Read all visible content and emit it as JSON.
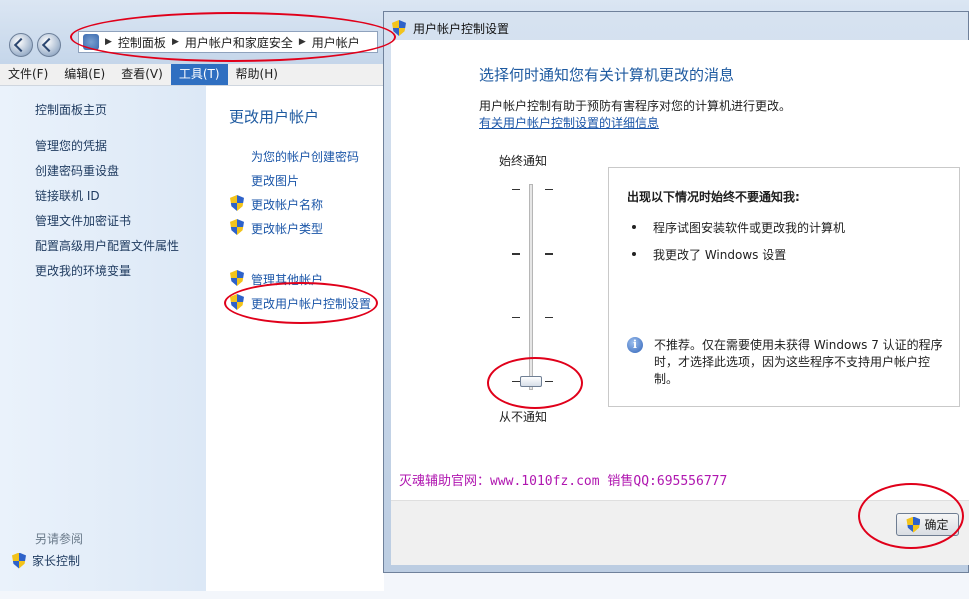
{
  "breadcrumb": [
    "控制面板",
    "用户帐户和家庭安全",
    "用户帐户"
  ],
  "menu": [
    "文件(F)",
    "编辑(E)",
    "查看(V)",
    "工具(T)",
    "帮助(H)"
  ],
  "menu_active_index": 3,
  "left_links": {
    "home": "控制面板主页",
    "items": [
      "管理您的凭据",
      "创建密码重设盘",
      "链接联机 ID",
      "管理文件加密证书",
      "配置高级用户配置文件属性",
      "更改我的环境变量"
    ]
  },
  "see_also": {
    "label": "另请参阅",
    "parental": "家长控制"
  },
  "main": {
    "title": "更改用户帐户",
    "tasks": [
      "为您的帐户创建密码",
      "更改图片",
      "更改帐户名称",
      "更改帐户类型"
    ],
    "tasks2": [
      "管理其他帐户",
      "更改用户帐户控制设置"
    ]
  },
  "dialog": {
    "title": "用户帐户控制设置",
    "heading": "选择何时通知您有关计算机更改的消息",
    "desc": "用户帐户控制有助于预防有害程序对您的计算机进行更改。",
    "more_link": "有关用户帐户控制设置的详细信息",
    "slider_top": "始终通知",
    "slider_bottom": "从不通知",
    "slider_level": 0,
    "info_title": "出现以下情况时始终不要通知我:",
    "bullets": [
      "程序试图安装软件或更改我的计算机",
      "我更改了 Windows 设置"
    ],
    "note": "不推荐。仅在需要使用未获得 Windows 7 认证的程序时，才选择此选项，因为这些程序不支持用户帐户控制。",
    "ok": "确定"
  },
  "promo": "灭魂辅助官网：www.1010fz.com  销售QQ:695556777",
  "colors": {
    "link": "#1b56a8",
    "heading": "#1e5aa0",
    "annotation": "#e0001a",
    "promo": "#b017b0"
  }
}
